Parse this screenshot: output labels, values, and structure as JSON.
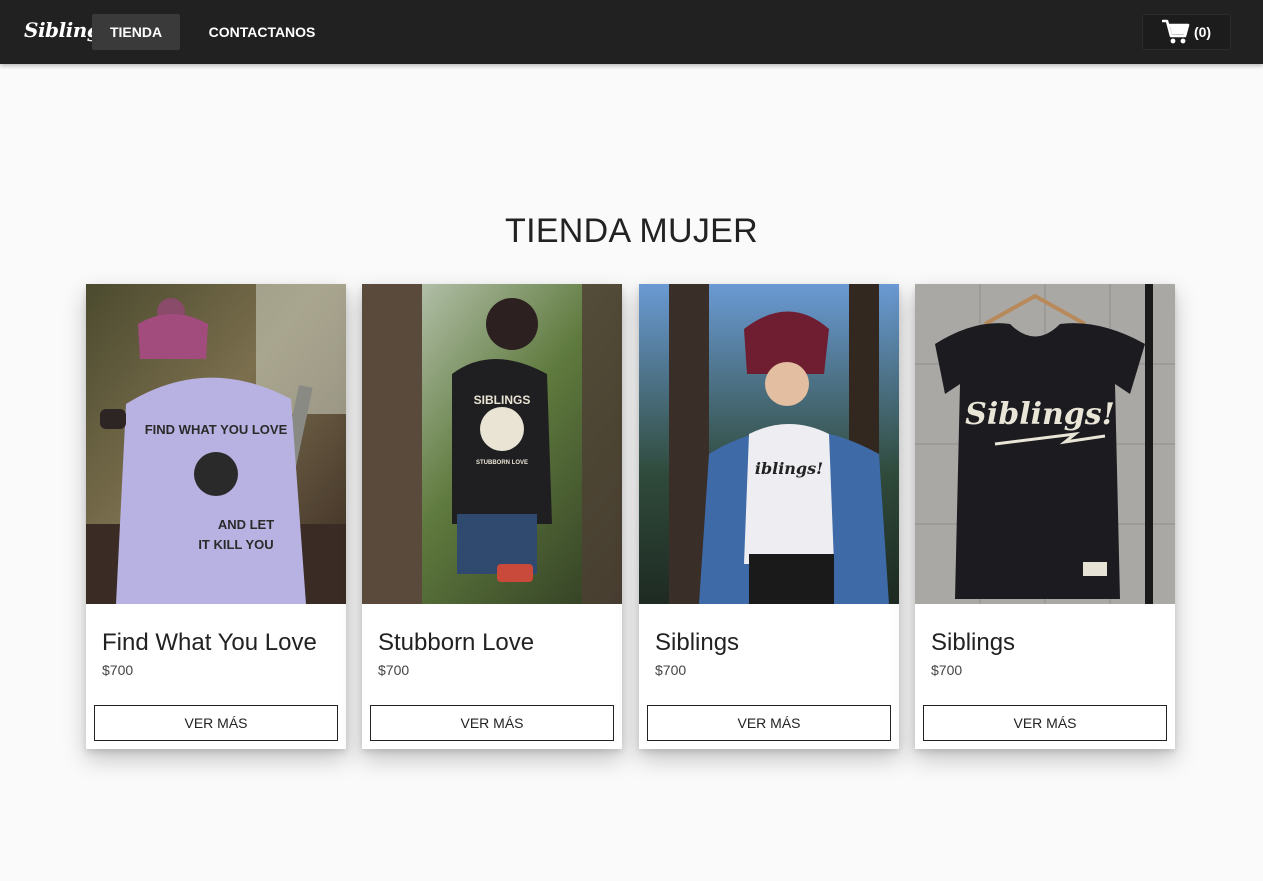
{
  "navbar": {
    "brand": "Siblings",
    "items": [
      {
        "label": "TIENDA",
        "active": true
      },
      {
        "label": "CONTACTANOS",
        "active": false
      }
    ],
    "cart": {
      "icon": "cart-icon",
      "count_label": "(0)"
    }
  },
  "main": {
    "title": "TIENDA MUJER",
    "products": [
      {
        "name": "Find What You Love",
        "price": "$700",
        "button_label": "VER MÁS",
        "shirt_print": "FIND WHAT YOU LOVE AND LET IT KILL YOU"
      },
      {
        "name": "Stubborn Love",
        "price": "$700",
        "button_label": "VER MÁS",
        "shirt_print": "SIBLINGS STUBBORN LOVE"
      },
      {
        "name": "Siblings",
        "price": "$700",
        "button_label": "VER MÁS",
        "shirt_print": "Siblings!"
      },
      {
        "name": "Siblings",
        "price": "$700",
        "button_label": "VER MÁS",
        "shirt_print": "Siblings!"
      }
    ]
  },
  "colors": {
    "navbar_bg": "#212121",
    "active_tab_bg": "#3a3a3a",
    "page_bg": "#fafafa",
    "text": "#222222"
  }
}
